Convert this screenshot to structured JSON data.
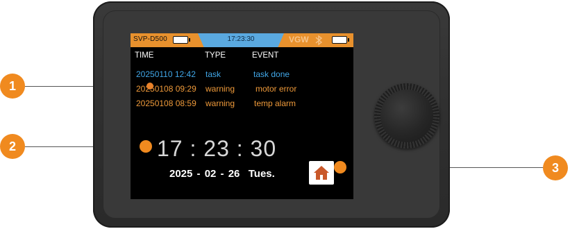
{
  "status_bar": {
    "model": "SVP-D500",
    "time": "17:23:30",
    "gateway": "VGW",
    "bluetooth_icon": "bluetooth-icon",
    "battery_icon": "battery-icon"
  },
  "event_table": {
    "headers": [
      "TIME",
      "TYPE",
      "EVENT"
    ],
    "rows": [
      {
        "time": "20250110 12:42",
        "type": "task",
        "event": "task done",
        "color": "#41a7e8"
      },
      {
        "time": "20250108 09:29",
        "type": "warning",
        "event": "motor error",
        "color": "#ef9a3a"
      },
      {
        "time": "20250108 08:59",
        "type": "warning",
        "event": "temp alarm",
        "color": "#ef9a3a"
      }
    ]
  },
  "clock": {
    "time": "17 : 23 : 30",
    "date": "2025 - 02 - 26  Tues."
  },
  "home_button": {
    "icon": "home-icon"
  },
  "callouts": [
    "1",
    "2",
    "3"
  ],
  "colors": {
    "status_bar": "#e8912d",
    "time_tab": "#5aa9e0",
    "callout": "#f08a1f",
    "task": "#41a7e8",
    "warning": "#ef9a3a"
  }
}
